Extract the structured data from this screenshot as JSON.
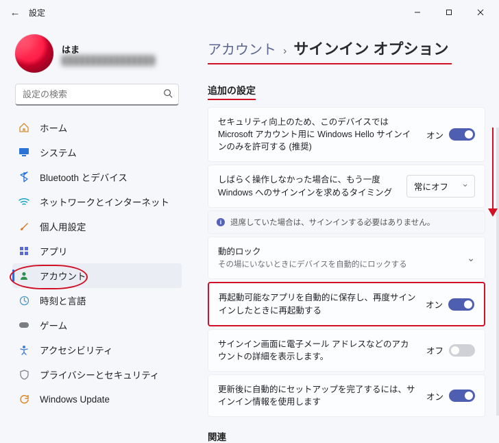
{
  "titlebar": {
    "back_glyph": "←",
    "title": "設定"
  },
  "profile": {
    "name": "はま",
    "email_masked": "████████████████"
  },
  "search": {
    "placeholder": "設定の検索"
  },
  "sidebar": {
    "items": [
      {
        "label": "ホーム"
      },
      {
        "label": "システム"
      },
      {
        "label": "Bluetooth とデバイス"
      },
      {
        "label": "ネットワークとインターネット"
      },
      {
        "label": "個人用設定"
      },
      {
        "label": "アプリ"
      },
      {
        "label": "アカウント"
      },
      {
        "label": "時刻と言語"
      },
      {
        "label": "ゲーム"
      },
      {
        "label": "アクセシビリティ"
      },
      {
        "label": "プライバシーとセキュリティ"
      },
      {
        "label": "Windows Update"
      }
    ],
    "selected_index": 6
  },
  "breadcrumb": {
    "root": "アカウント",
    "sep": "›",
    "leaf": "サインイン オプション"
  },
  "section_additional": "追加の設定",
  "cards": {
    "hello": {
      "text": "セキュリティ向上のため、このデバイスでは Microsoft アカウント用に Windows Hello サインインのみを許可する (推奨)",
      "state_label": "オン",
      "on": true
    },
    "reauth": {
      "text": "しばらく操作しなかった場合に、もう一度 Windows へのサインインを求めるタイミング",
      "select_value": "常にオフ"
    },
    "info": {
      "text": "退席していた場合は、サインインする必要はありません。"
    },
    "dynlock": {
      "title": "動的ロック",
      "sub": "その場にいないときにデバイスを自動的にロックする"
    },
    "restart_apps": {
      "text": "再起動可能なアプリを自動的に保存し、再度サインインしたときに再起動する",
      "state_label": "オン",
      "on": true
    },
    "show_email": {
      "text": "サインイン画面に電子メール アドレスなどのアカウントの詳細を表示します。",
      "state_label": "オフ",
      "on": false
    },
    "finish_setup": {
      "text": "更新後に自動的にセットアップを完了するには、サインイン情報を使用します",
      "state_label": "オン",
      "on": true
    }
  },
  "related_heading": "関連"
}
